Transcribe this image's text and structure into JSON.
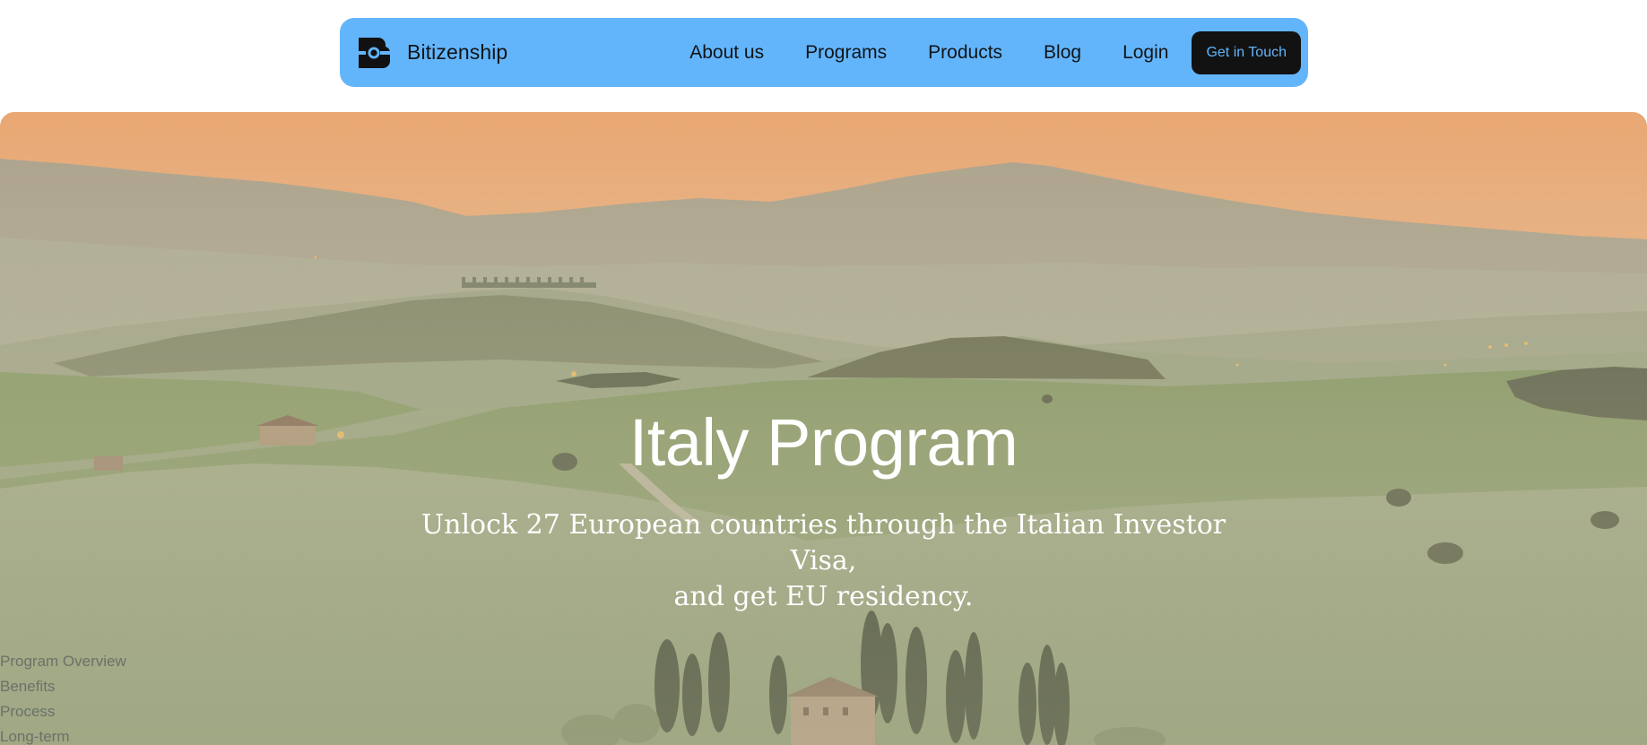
{
  "brand": {
    "name": "Bitizenship",
    "logo_icon": "bitizenship-logo-icon"
  },
  "nav": {
    "items": [
      {
        "label": "About us"
      },
      {
        "label": "Programs"
      },
      {
        "label": "Products"
      },
      {
        "label": "Blog"
      },
      {
        "label": "Login"
      }
    ],
    "cta_label": "Get in Touch"
  },
  "hero": {
    "title": "Italy Program",
    "subtitle_line1": "Unlock 27 European countries through the Italian Investor Visa,",
    "subtitle_line2": "and get EU residency."
  },
  "section_nav": {
    "items": [
      {
        "label": "Program Overview"
      },
      {
        "label": "Benefits"
      },
      {
        "label": "Process"
      },
      {
        "label": "Long-term"
      }
    ]
  },
  "colors": {
    "nav_background": "#63b5fb",
    "cta_background": "#121212",
    "cta_text": "#63b5fb",
    "hero_text": "#ffffff",
    "sky_top": "#f8b27a",
    "hills": "#8a9a6a"
  }
}
